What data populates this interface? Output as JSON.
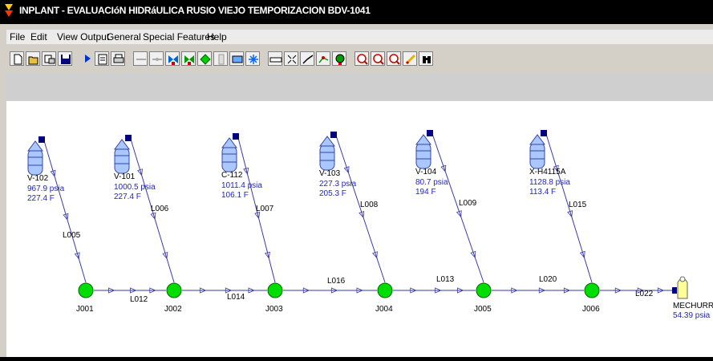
{
  "window": {
    "title": "INPLANT - EVALUACIóN HIDRáULICA RUSIO VIEJO TEMPORIZACION BDV-1041"
  },
  "menu": [
    "File",
    "Edit",
    "View Output",
    "General",
    "Special Features",
    "Help"
  ],
  "toolbar": {
    "buttons": [
      "new-icon",
      "open-icon",
      "import-icon",
      "save-icon",
      "run-icon",
      "report-icon",
      "print-icon",
      "pipe-icon",
      "pipe-icon",
      "valve-icon",
      "valve-icon",
      "junction-icon",
      "column-icon",
      "exchanger-icon",
      "snowflake-icon",
      "ruler-icon",
      "fit-icon",
      "line-chart-icon",
      "scatter-chart-icon",
      "globe-icon",
      "zoom-in-icon",
      "zoom-out-icon",
      "zoom-window-icon",
      "pencil-icon",
      "binoculars-icon"
    ]
  },
  "colors": {
    "link": "#3a3aaa",
    "label": "#2222cc",
    "junction_fill": "#00dd00",
    "sink_fill": "#ffff99"
  },
  "network": {
    "sources": [
      {
        "name": "V-102",
        "pressure": "967.9 psia",
        "temp": "227.4 F"
      },
      {
        "name": "V-101",
        "pressure": "1000.5 psia",
        "temp": "227.4 F"
      },
      {
        "name": "C-112",
        "pressure": "1011.4 psia",
        "temp": "106.1 F"
      },
      {
        "name": "V-103",
        "pressure": "227.3 psia",
        "temp": "205.3 F"
      },
      {
        "name": "V-104",
        "pressure": "80.7 psia",
        "temp": "194 F"
      },
      {
        "name": "X-H4115A",
        "pressure": "1128.8 psia",
        "temp": "113.4 F"
      }
    ],
    "junctions": [
      "J001",
      "J002",
      "J003",
      "J004",
      "J005",
      "J006"
    ],
    "feed_links": [
      "L005",
      "L006",
      "L007",
      "L008",
      "L009",
      "L015"
    ],
    "header_links": [
      "L012",
      "L014",
      "L016",
      "L013",
      "L020",
      "L022"
    ],
    "sink": {
      "name": "MECHURRIO",
      "pressure": "54.39 psia"
    }
  }
}
